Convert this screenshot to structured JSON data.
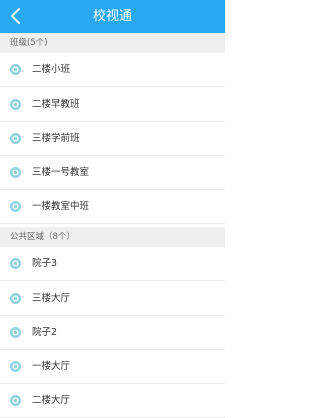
{
  "header": {
    "title": "校视通",
    "background": "#29a8f1",
    "back_icon": "chevron-left-icon"
  },
  "sections": [
    {
      "title": "班级(5个)",
      "items": [
        {
          "label": "二楼小班",
          "icon": "camera-lens-icon"
        },
        {
          "label": "二楼早教班",
          "icon": "camera-lens-icon"
        },
        {
          "label": "三楼学前班",
          "icon": "camera-lens-icon"
        },
        {
          "label": "三楼一号教室",
          "icon": "camera-lens-icon"
        },
        {
          "label": "一楼教室中班",
          "icon": "camera-lens-icon"
        }
      ]
    },
    {
      "title": "公共区域（8个）",
      "items": [
        {
          "label": "院子3",
          "icon": "camera-lens-icon"
        },
        {
          "label": "三楼大厅",
          "icon": "camera-lens-icon"
        },
        {
          "label": "院子2",
          "icon": "camera-lens-icon"
        },
        {
          "label": "一楼大厅",
          "icon": "camera-lens-icon"
        },
        {
          "label": "二楼大厅",
          "icon": "camera-lens-icon"
        }
      ]
    }
  ],
  "colors": {
    "icon": "#8fd3e0",
    "section_bg": "#efefef"
  }
}
